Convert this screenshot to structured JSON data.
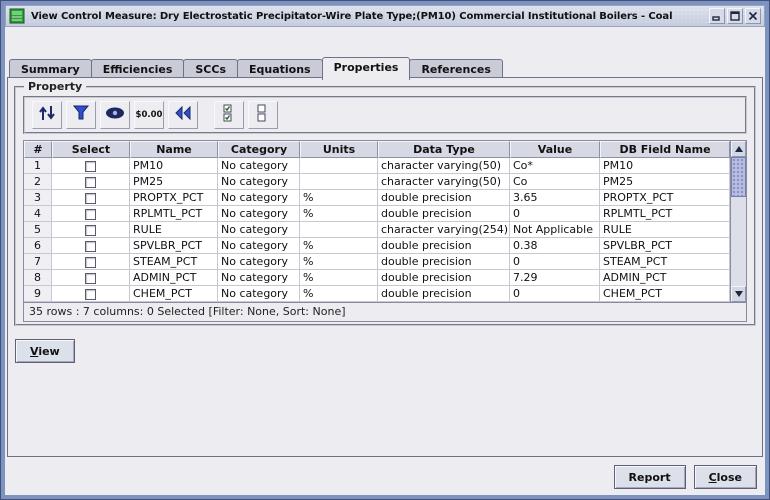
{
  "colors": {
    "frame_border": "#7C92C0",
    "titlebar_bg": "#D4D9E6",
    "panel_bg": "#EDEDF1",
    "table_header_bg": "#D6D8E4",
    "scroll_thumb": "#B6BCE2",
    "icon_blue": "#2E4FD0"
  },
  "window": {
    "title": "View Control Measure: Dry Electrostatic Precipitator-Wire Plate Type;(PM10) Commercial Institutional Boilers - Coal"
  },
  "tabs": [
    {
      "label": "Summary"
    },
    {
      "label": "Efficiencies"
    },
    {
      "label": "SCCs"
    },
    {
      "label": "Equations"
    },
    {
      "label": "Properties"
    },
    {
      "label": "References"
    }
  ],
  "active_tab": "Properties",
  "panel": {
    "title": "Property"
  },
  "toolbar": {
    "icons": [
      "sort-icon",
      "filter-icon",
      "show-columns-icon",
      "format-icon",
      "reset-icon",
      "select-all-icon",
      "clear-all-icon"
    ],
    "format_label": "$0.00"
  },
  "table": {
    "columns": [
      "#",
      "Select",
      "Name",
      "Category",
      "Units",
      "Data Type",
      "Value",
      "DB Field Name"
    ],
    "rows": [
      {
        "num": "1",
        "name": "PM10",
        "category": "No category",
        "units": "",
        "data_type": "character varying(50)",
        "value": "Co*",
        "db_field": "PM10"
      },
      {
        "num": "2",
        "name": "PM25",
        "category": "No category",
        "units": "",
        "data_type": "character varying(50)",
        "value": "Co",
        "db_field": "PM25"
      },
      {
        "num": "3",
        "name": "PROPTX_PCT",
        "category": "No category",
        "units": "%",
        "data_type": "double precision",
        "value": "3.65",
        "db_field": "PROPTX_PCT"
      },
      {
        "num": "4",
        "name": "RPLMTL_PCT",
        "category": "No category",
        "units": "%",
        "data_type": "double precision",
        "value": "0",
        "db_field": "RPLMTL_PCT"
      },
      {
        "num": "5",
        "name": "RULE",
        "category": "No category",
        "units": "",
        "data_type": "character varying(254)",
        "value": "Not Applicable",
        "db_field": "RULE"
      },
      {
        "num": "6",
        "name": "SPVLBR_PCT",
        "category": "No category",
        "units": "%",
        "data_type": "double precision",
        "value": "0.38",
        "db_field": "SPVLBR_PCT"
      },
      {
        "num": "7",
        "name": "STEAM_PCT",
        "category": "No category",
        "units": "%",
        "data_type": "double precision",
        "value": "0",
        "db_field": "STEAM_PCT"
      },
      {
        "num": "8",
        "name": "ADMIN_PCT",
        "category": "No category",
        "units": "%",
        "data_type": "double precision",
        "value": "7.29",
        "db_field": "ADMIN_PCT"
      },
      {
        "num": "9",
        "name": "CHEM_PCT",
        "category": "No category",
        "units": "%",
        "data_type": "double precision",
        "value": "0",
        "db_field": "CHEM_PCT"
      }
    ]
  },
  "status": "35 rows : 7 columns: 0 Selected [Filter: None, Sort: None]",
  "buttons": {
    "view": "View",
    "report": "Report",
    "close": "Close"
  }
}
